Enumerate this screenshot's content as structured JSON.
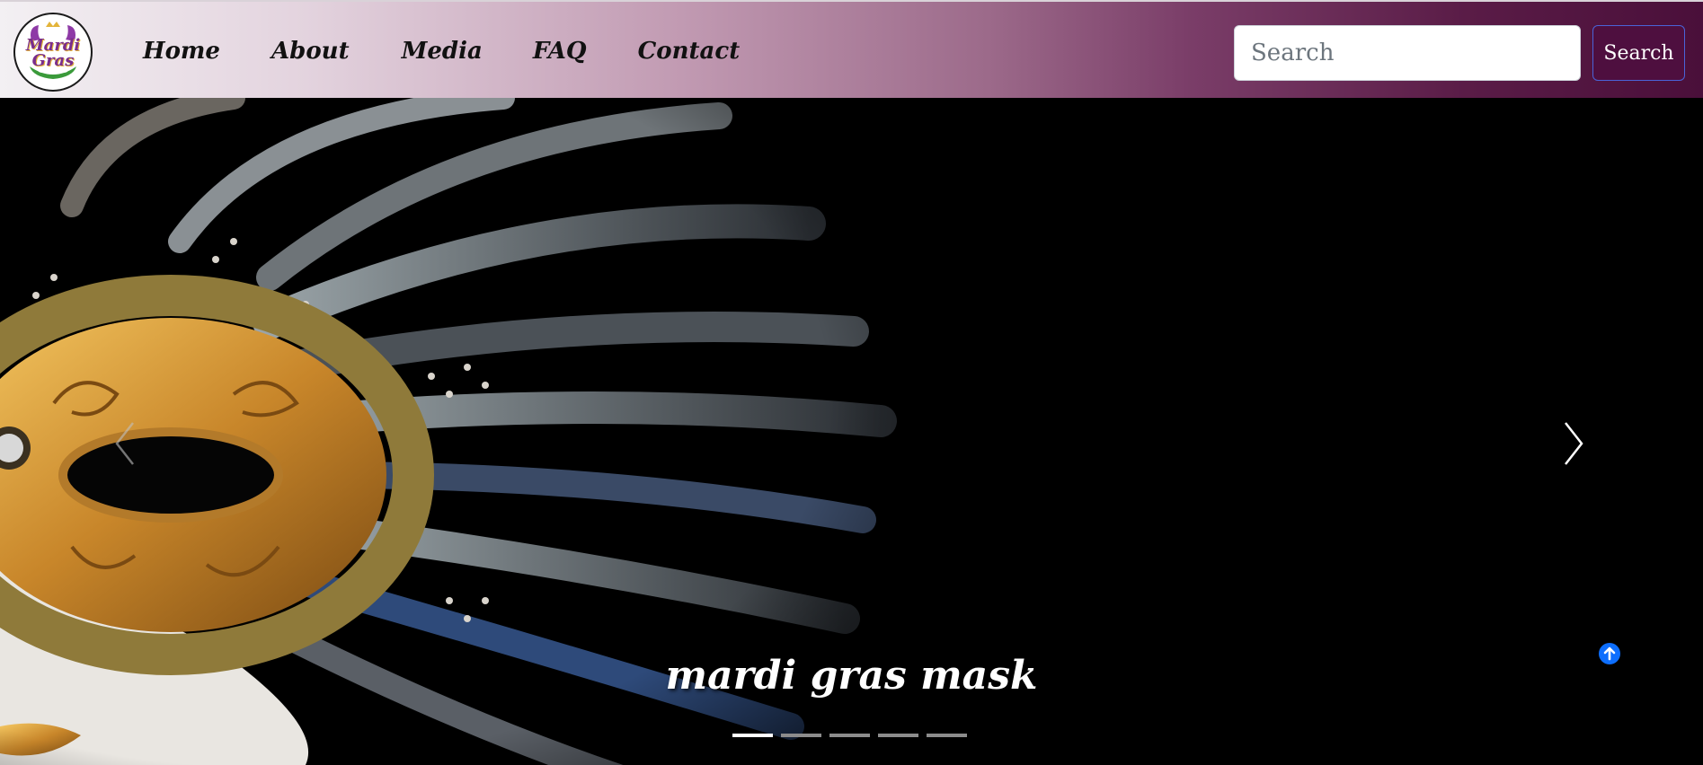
{
  "logo": {
    "text": "Mardi Gras",
    "icon": "mardi-gras-logo"
  },
  "nav": {
    "links": [
      {
        "label": "Home"
      },
      {
        "label": "About"
      },
      {
        "label": "Media"
      },
      {
        "label": "FAQ"
      },
      {
        "label": "Contact"
      }
    ]
  },
  "search": {
    "placeholder": "Search",
    "value": "",
    "button_label": "Search"
  },
  "carousel": {
    "caption": "mardi gras mask",
    "slide_count": 5,
    "active_slide": 1,
    "prev_icon": "chevron-left-icon",
    "next_icon": "chevron-right-icon"
  },
  "scroll_top": {
    "icon": "arrow-up-circle-icon"
  },
  "colors": {
    "nav_gradient_start": "#f3f0f3",
    "nav_gradient_end": "#4a0f3a",
    "search_button_bg": "#4e0f3f",
    "accent_blue": "#0d6efd",
    "hero_bg": "#000000"
  }
}
